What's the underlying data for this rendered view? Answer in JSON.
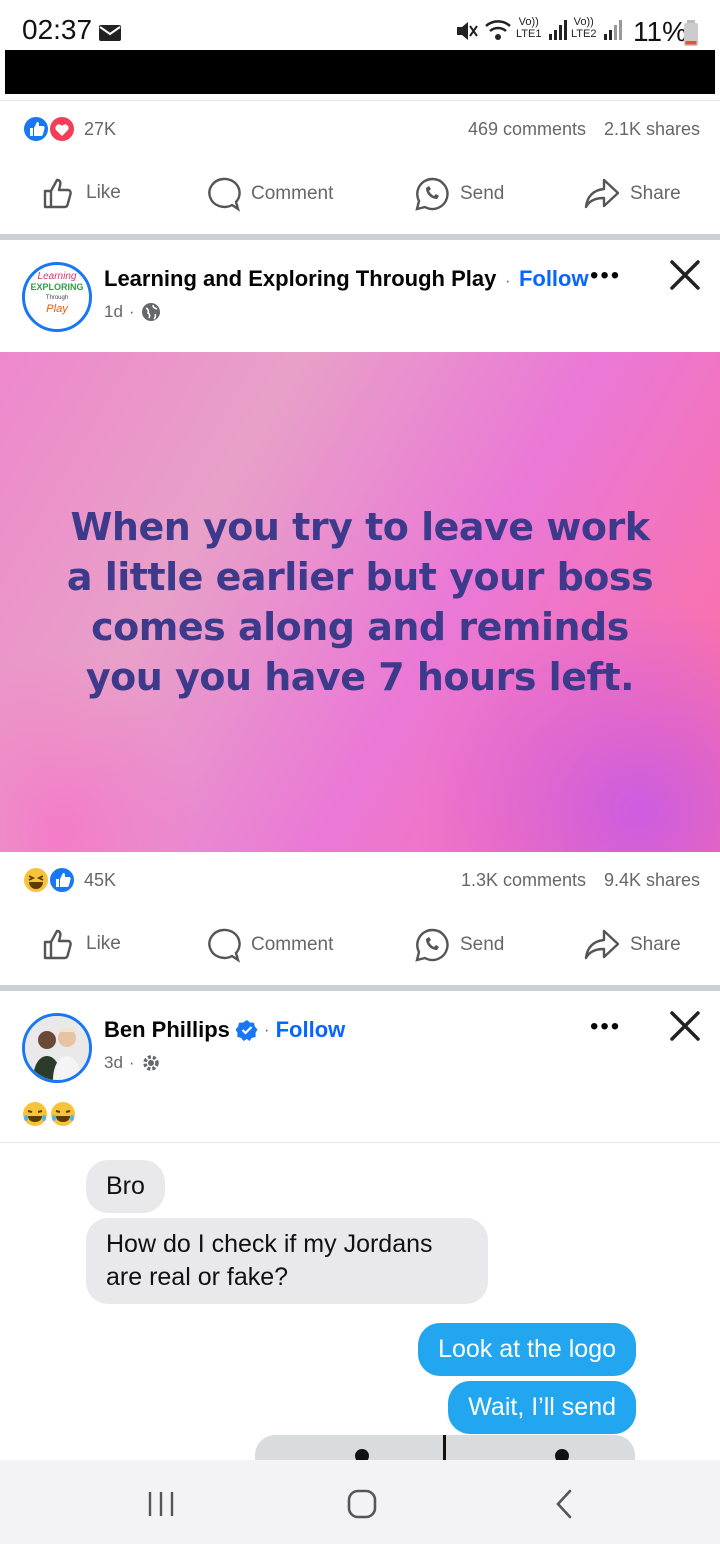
{
  "status_bar": {
    "time": "02:37",
    "battery": "11%",
    "lte1": "LTE1",
    "lte2": "LTE2",
    "volte": "Vo))"
  },
  "post1": {
    "reactions_count": "27K",
    "comments": "469 comments",
    "shares": "2.1K shares"
  },
  "actions": {
    "like": "Like",
    "comment": "Comment",
    "send": "Send",
    "share": "Share"
  },
  "post2": {
    "page_name": "Learning and Exploring Through Play",
    "separator": "·",
    "follow": "Follow",
    "time": "1d",
    "dot": "·",
    "text": "When you try to leave work a little earlier but your boss comes along and reminds you you have 7 hours left.",
    "reactions_count": "45K",
    "comments": "1.3K comments",
    "shares": "9.4K shares",
    "logo_lines": [
      "Learning",
      "EXPLORING",
      "Through",
      "Play"
    ]
  },
  "post3": {
    "author": "Ben Phillips",
    "separator": "·",
    "follow": "Follow",
    "time": "3d",
    "dot": "·",
    "messages": [
      {
        "side": "left",
        "text": "Bro"
      },
      {
        "side": "left",
        "text": "How do I check if my Jordans are real or fake?"
      },
      {
        "side": "right",
        "text": "Look at the logo"
      },
      {
        "side": "right",
        "text": "Wait, I’ll send"
      }
    ]
  },
  "colors": {
    "accent": "#0866ff",
    "bubble_blue": "#23a6f0",
    "post_text": "#3d3a8c"
  }
}
